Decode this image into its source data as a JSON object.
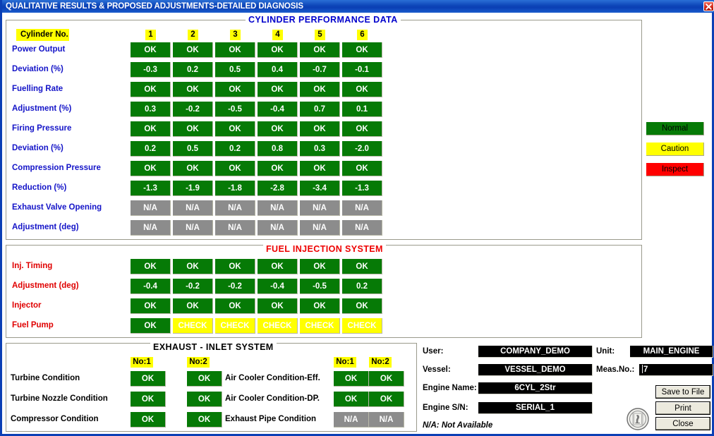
{
  "window": {
    "title": "QUALITATIVE RESULTS & PROPOSED ADJUSTMENTS-DETAILED DIAGNOSIS",
    "close_label": "Close window"
  },
  "cylinder_panel": {
    "title": "CYLINDER PERFORMANCE DATA",
    "header_label": "Cylinder No.",
    "columns": [
      "1",
      "2",
      "3",
      "4",
      "5",
      "6"
    ],
    "rows": [
      {
        "label": "Power Output",
        "values": [
          "OK",
          "OK",
          "OK",
          "OK",
          "OK",
          "OK"
        ],
        "states": [
          "ok",
          "ok",
          "ok",
          "ok",
          "ok",
          "ok"
        ]
      },
      {
        "label": "Deviation (%)",
        "values": [
          "-0.3",
          "0.2",
          "0.5",
          "0.4",
          "-0.7",
          "-0.1"
        ],
        "states": [
          "ok",
          "ok",
          "ok",
          "ok",
          "ok",
          "ok"
        ]
      },
      {
        "label": "Fuelling Rate",
        "values": [
          "OK",
          "OK",
          "OK",
          "OK",
          "OK",
          "OK"
        ],
        "states": [
          "ok",
          "ok",
          "ok",
          "ok",
          "ok",
          "ok"
        ]
      },
      {
        "label": "Adjustment  (%)",
        "values": [
          "0.3",
          "-0.2",
          "-0.5",
          "-0.4",
          "0.7",
          "0.1"
        ],
        "states": [
          "ok",
          "ok",
          "ok",
          "ok",
          "ok",
          "ok"
        ]
      },
      {
        "label": "Firing Pressure",
        "values": [
          "OK",
          "OK",
          "OK",
          "OK",
          "OK",
          "OK"
        ],
        "states": [
          "ok",
          "ok",
          "ok",
          "ok",
          "ok",
          "ok"
        ]
      },
      {
        "label": "Deviation (%)",
        "values": [
          "0.2",
          "0.5",
          "0.2",
          "0.8",
          "0.3",
          "-2.0"
        ],
        "states": [
          "ok",
          "ok",
          "ok",
          "ok",
          "ok",
          "ok"
        ]
      },
      {
        "label": "Compression Pressure",
        "values": [
          "OK",
          "OK",
          "OK",
          "OK",
          "OK",
          "OK"
        ],
        "states": [
          "ok",
          "ok",
          "ok",
          "ok",
          "ok",
          "ok"
        ]
      },
      {
        "label": "Reduction (%)",
        "values": [
          "-1.3",
          "-1.9",
          "-1.8",
          "-2.8",
          "-3.4",
          "-1.3"
        ],
        "states": [
          "ok",
          "ok",
          "ok",
          "ok",
          "ok",
          "ok"
        ]
      },
      {
        "label": "Exhaust Valve Opening",
        "values": [
          "N/A",
          "N/A",
          "N/A",
          "N/A",
          "N/A",
          "N/A"
        ],
        "states": [
          "na",
          "na",
          "na",
          "na",
          "na",
          "na"
        ]
      },
      {
        "label": "Adjustment (deg)",
        "values": [
          "N/A",
          "N/A",
          "N/A",
          "N/A",
          "N/A",
          "N/A"
        ],
        "states": [
          "na",
          "na",
          "na",
          "na",
          "na",
          "na"
        ]
      }
    ]
  },
  "fuel_panel": {
    "title": "FUEL INJECTION SYSTEM",
    "rows": [
      {
        "label": "Inj. Timing",
        "values": [
          "OK",
          "OK",
          "OK",
          "OK",
          "OK",
          "OK"
        ],
        "states": [
          "ok",
          "ok",
          "ok",
          "ok",
          "ok",
          "ok"
        ]
      },
      {
        "label": "Adjustment (deg)",
        "values": [
          "-0.4",
          "-0.2",
          "-0.2",
          "-0.4",
          "-0.5",
          "0.2"
        ],
        "states": [
          "ok",
          "ok",
          "ok",
          "ok",
          "ok",
          "ok"
        ]
      },
      {
        "label": "Injector",
        "values": [
          "OK",
          "OK",
          "OK",
          "OK",
          "OK",
          "OK"
        ],
        "states": [
          "ok",
          "ok",
          "ok",
          "ok",
          "ok",
          "ok"
        ]
      },
      {
        "label": "Fuel Pump",
        "values": [
          "OK",
          "CHECK",
          "CHECK",
          "CHECK",
          "CHECK",
          "CHECK"
        ],
        "states": [
          "ok",
          "check",
          "check",
          "check",
          "check",
          "check"
        ]
      }
    ]
  },
  "exhaust_panel": {
    "title": "EXHAUST - INLET SYSTEM",
    "left_headers": [
      "No:1",
      "No:2"
    ],
    "right_headers": [
      "No:1",
      "No:2"
    ],
    "left_rows": [
      {
        "label": "Turbine Condition",
        "values": [
          "OK",
          "OK"
        ],
        "states": [
          "ok",
          "ok"
        ]
      },
      {
        "label": "Turbine Nozzle Condition",
        "values": [
          "OK",
          "OK"
        ],
        "states": [
          "ok",
          "ok"
        ]
      },
      {
        "label": "Compressor Condition",
        "values": [
          "OK",
          "OK"
        ],
        "states": [
          "ok",
          "ok"
        ]
      }
    ],
    "right_rows": [
      {
        "label": "Air Cooler Condition-Eff.",
        "values": [
          "OK",
          "OK"
        ],
        "states": [
          "ok",
          "ok"
        ]
      },
      {
        "label": "Air Cooler Condition-DP.",
        "values": [
          "OK",
          "OK"
        ],
        "states": [
          "ok",
          "ok"
        ]
      },
      {
        "label": "Exhaust Pipe Condition",
        "values": [
          "N/A",
          "N/A"
        ],
        "states": [
          "na",
          "na"
        ]
      }
    ]
  },
  "legend": {
    "items": [
      {
        "label": "Normal",
        "color": "#067a06"
      },
      {
        "label": "Caution",
        "color": "#ffff00"
      },
      {
        "label": "Inspect",
        "color": "#ff0000"
      }
    ]
  },
  "info": {
    "user_label": "User:",
    "user_value": "COMPANY_DEMO",
    "unit_label": "Unit:",
    "unit_value": "MAIN_ENGINE",
    "vessel_label": "Vessel:",
    "vessel_value": "VESSEL_DEMO",
    "meas_label": "Meas.No.:",
    "meas_value": "7",
    "engine_name_label": "Engine Name:",
    "engine_name_value": "6CYL_2Str",
    "engine_sn_label": "Engine S/N:",
    "engine_sn_value": "SERIAL_1",
    "na_note": "N/A: Not Available"
  },
  "buttons": {
    "save": "Save to File",
    "print": "Print",
    "close": "Close"
  }
}
